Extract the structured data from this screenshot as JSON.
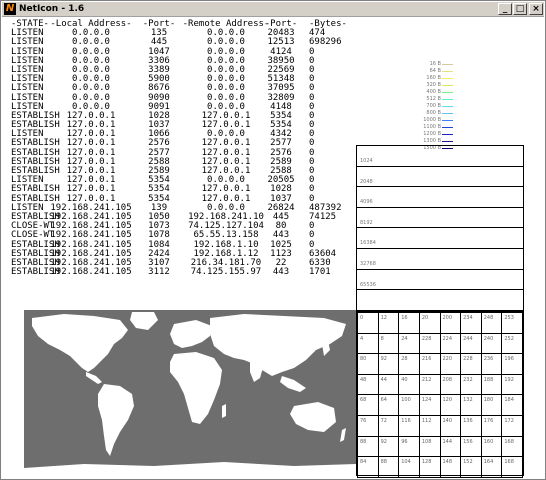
{
  "window": {
    "title": "NetIcon - 1.6",
    "app_icon": "N"
  },
  "titlebar_buttons": {
    "minimize": "_",
    "maximize": "□",
    "close": "×"
  },
  "table": {
    "headers": [
      "-STATE-",
      "-Local Address-",
      "-Port-",
      "-Remote Address-",
      "-Port-",
      "-Bytes-"
    ],
    "rows": [
      [
        "LISTEN",
        "0.0.0.0",
        "135",
        "0.0.0.0",
        "20483",
        "474"
      ],
      [
        "LISTEN",
        "0.0.0.0",
        "445",
        "0.0.0.0",
        "12513",
        "698296"
      ],
      [
        "LISTEN",
        "0.0.0.0",
        "1047",
        "0.0.0.0",
        "4124",
        "0"
      ],
      [
        "LISTEN",
        "0.0.0.0",
        "3306",
        "0.0.0.0",
        "38950",
        "0"
      ],
      [
        "LISTEN",
        "0.0.0.0",
        "3389",
        "0.0.0.0",
        "22569",
        "0"
      ],
      [
        "LISTEN",
        "0.0.0.0",
        "5900",
        "0.0.0.0",
        "51348",
        "0"
      ],
      [
        "LISTEN",
        "0.0.0.0",
        "8676",
        "0.0.0.0",
        "37095",
        "0"
      ],
      [
        "LISTEN",
        "0.0.0.0",
        "9090",
        "0.0.0.0",
        "32809",
        "0"
      ],
      [
        "LISTEN",
        "0.0.0.0",
        "9091",
        "0.0.0.0",
        "4148",
        "0"
      ],
      [
        "ESTABLISH",
        "127.0.0.1",
        "1028",
        "127.0.0.1",
        "5354",
        "0"
      ],
      [
        "ESTABLISH",
        "127.0.0.1",
        "1037",
        "127.0.0.1",
        "5354",
        "0"
      ],
      [
        "LISTEN",
        "127.0.0.1",
        "1066",
        "0.0.0.0",
        "4342",
        "0"
      ],
      [
        "ESTABLISH",
        "127.0.0.1",
        "2576",
        "127.0.0.1",
        "2577",
        "0"
      ],
      [
        "ESTABLISH",
        "127.0.0.1",
        "2577",
        "127.0.0.1",
        "2576",
        "0"
      ],
      [
        "ESTABLISH",
        "127.0.0.1",
        "2588",
        "127.0.0.1",
        "2589",
        "0"
      ],
      [
        "ESTABLISH",
        "127.0.0.1",
        "2589",
        "127.0.0.1",
        "2588",
        "0"
      ],
      [
        "LISTEN",
        "127.0.0.1",
        "5354",
        "0.0.0.0",
        "20505",
        "0"
      ],
      [
        "ESTABLISH",
        "127.0.0.1",
        "5354",
        "127.0.0.1",
        "1028",
        "0"
      ],
      [
        "ESTABLISH",
        "127.0.0.1",
        "5354",
        "127.0.0.1",
        "1037",
        "0"
      ],
      [
        "LISTEN",
        "192.168.241.105",
        "139",
        "0.0.0.0",
        "26824",
        "487392"
      ],
      [
        "ESTABLISH",
        "192.168.241.105",
        "1050",
        "192.168.241.10",
        "445",
        "74125"
      ],
      [
        "CLOSE-WT",
        "192.168.241.105",
        "1073",
        "74.125.127.104",
        "80",
        "0"
      ],
      [
        "CLOSE-WT",
        "192.168.241.105",
        "1078",
        "65.55.13.158",
        "443",
        "0"
      ],
      [
        "ESTABLISH",
        "192.168.241.105",
        "1084",
        "192.168.1.10",
        "1025",
        "0"
      ],
      [
        "ESTABLISH",
        "192.168.241.105",
        "2424",
        "192.168.1.12",
        "1123",
        "63604"
      ],
      [
        "ESTABLISH",
        "192.168.241.105",
        "3107",
        "216.34.181.70",
        "22",
        "6330"
      ],
      [
        "ESTABLISH",
        "192.168.241.105",
        "3112",
        "74.125.155.97",
        "443",
        "1701"
      ]
    ]
  },
  "legend": {
    "items": [
      {
        "label": "16 B",
        "color": "#d8c8a0"
      },
      {
        "label": "64 B",
        "color": "#e8e080"
      },
      {
        "label": "160 B",
        "color": "#f0f060"
      },
      {
        "label": "320 B",
        "color": "#c8f060"
      },
      {
        "label": "400 B",
        "color": "#80f080"
      },
      {
        "label": "512 B",
        "color": "#60f0c0"
      },
      {
        "label": "700 B",
        "color": "#60e0f0"
      },
      {
        "label": "800 B",
        "color": "#60c0f0"
      },
      {
        "label": "1000 B",
        "color": "#4080f0"
      },
      {
        "label": "1100 B",
        "color": "#2040e0"
      },
      {
        "label": "1200 B",
        "color": "#2020c0"
      },
      {
        "label": "1300 B",
        "color": "#201890"
      },
      {
        "label": "1500 B",
        "color": "#200070"
      }
    ]
  },
  "scale_labels": [
    "1024",
    "2048",
    "4096",
    "8192",
    "16384",
    "32768",
    "65536",
    ""
  ],
  "port_grid": [
    [
      "0",
      "12",
      "16",
      "20",
      "200",
      "234",
      "248",
      "253"
    ],
    [
      "4",
      "8",
      "24",
      "228",
      "224",
      "244",
      "240",
      "252"
    ],
    [
      "80",
      "92",
      "28",
      "216",
      "220",
      "228",
      "236",
      "196"
    ],
    [
      "48",
      "44",
      "40",
      "212",
      "208",
      "232",
      "188",
      "192"
    ],
    [
      "68",
      "64",
      "100",
      "124",
      "120",
      "132",
      "180",
      "184"
    ],
    [
      "76",
      "72",
      "116",
      "112",
      "140",
      "136",
      "176",
      "172"
    ],
    [
      "88",
      "92",
      "96",
      "108",
      "144",
      "156",
      "160",
      "168"
    ],
    [
      "84",
      "88",
      "104",
      "128",
      "148",
      "152",
      "164",
      "168"
    ]
  ],
  "colors": {
    "map_water": "#6e6e6e",
    "map_land": "#ffffff",
    "titlebar": "#d4d0c8"
  }
}
